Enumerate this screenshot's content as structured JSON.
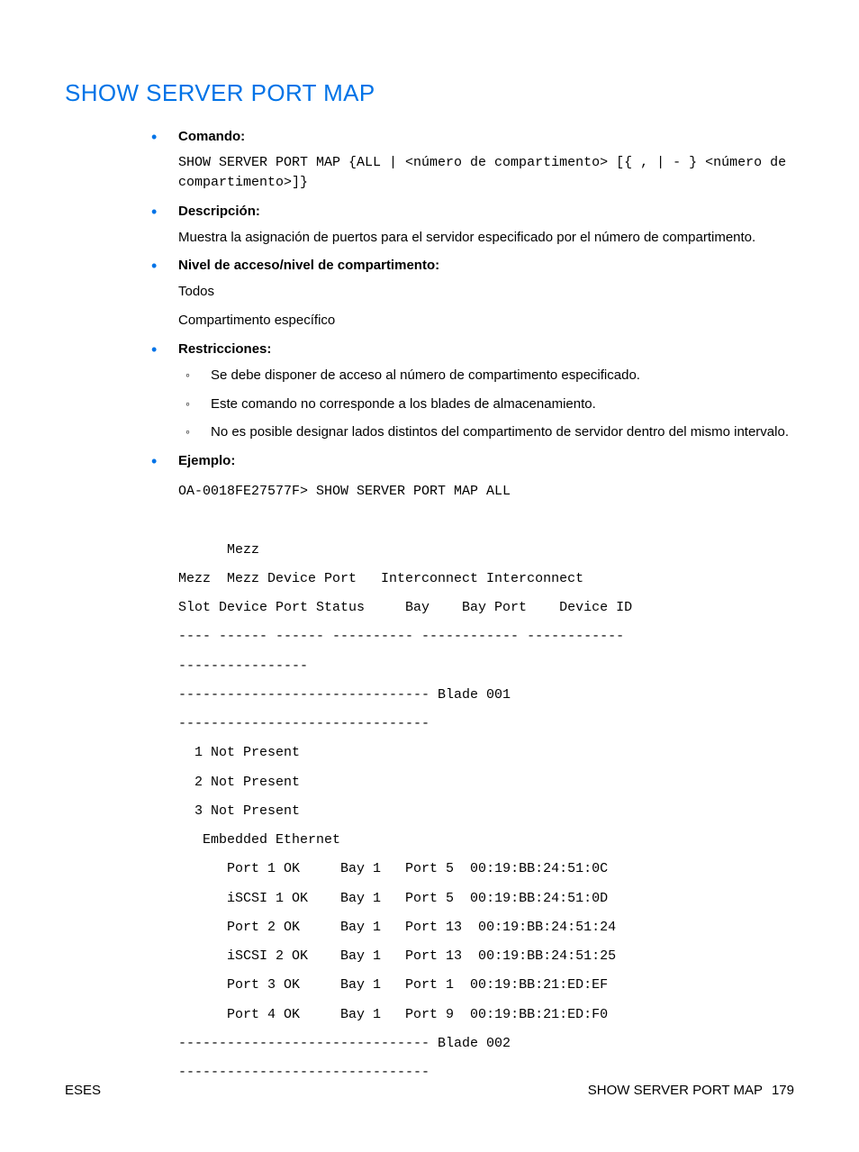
{
  "title": "SHOW SERVER PORT MAP",
  "sections": {
    "comando": {
      "label": "Comando:",
      "text": "SHOW SERVER PORT MAP {ALL | <número de compartimento> [{ , | - } <número de compartimento>]}"
    },
    "descripcion": {
      "label": "Descripción:",
      "text": "Muestra la asignación de puertos para el servidor especificado por el número de compartimento."
    },
    "nivel": {
      "label": "Nivel de acceso/nivel de compartimento:",
      "line1": "Todos",
      "line2": "Compartimento específico"
    },
    "restricciones": {
      "label": "Restricciones:",
      "items": [
        "Se debe disponer de acceso al número de compartimento especificado.",
        "Este comando no corresponde a los blades de almacenamiento.",
        "No es posible designar lados distintos del compartimento de servidor dentro del mismo intervalo."
      ]
    },
    "ejemplo": {
      "label": "Ejemplo:",
      "text": "OA-0018FE27577F> SHOW SERVER PORT MAP ALL\n\n      Mezz\nMezz  Mezz Device Port   Interconnect Interconnect\nSlot Device Port Status     Bay    Bay Port    Device ID\n---- ------ ------ ---------- ------------ ------------\n----------------\n------------------------------- Blade 001\n-------------------------------\n  1 Not Present\n  2 Not Present\n  3 Not Present\n   Embedded Ethernet\n      Port 1 OK     Bay 1   Port 5  00:19:BB:24:51:0C\n      iSCSI 1 OK    Bay 1   Port 5  00:19:BB:24:51:0D\n      Port 2 OK     Bay 1   Port 13  00:19:BB:24:51:24\n      iSCSI 2 OK    Bay 1   Port 13  00:19:BB:24:51:25\n      Port 3 OK     Bay 1   Port 1  00:19:BB:21:ED:EF\n      Port 4 OK     Bay 1   Port 9  00:19:BB:21:ED:F0\n------------------------------- Blade 002\n-------------------------------"
    }
  },
  "footer": {
    "left": "ESES",
    "right_label": "SHOW SERVER PORT MAP",
    "page": "179"
  }
}
